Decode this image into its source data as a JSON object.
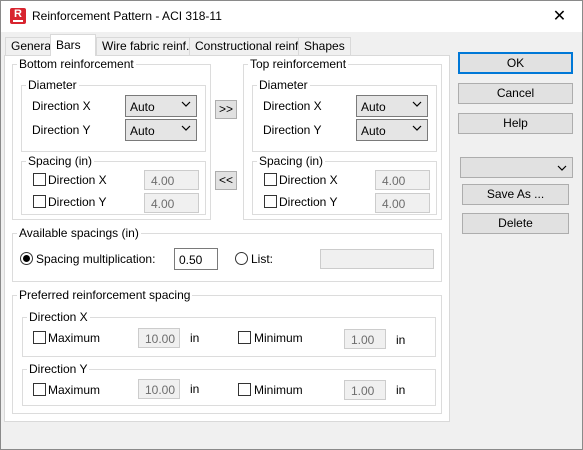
{
  "window": {
    "title": "Reinforcement Pattern - ACI 318-11",
    "close_glyph": "✕",
    "icon_letter": "R"
  },
  "tabs": [
    {
      "label": "General",
      "active": false
    },
    {
      "label": "Bars",
      "active": true
    },
    {
      "label": "Wire fabric reinf.",
      "active": false
    },
    {
      "label": "Constructional reinf.",
      "active": false
    },
    {
      "label": "Shapes",
      "active": false
    }
  ],
  "bottom": {
    "title": "Bottom reinforcement",
    "diameter": {
      "title": "Diameter",
      "x_label": "Direction X",
      "x_value": "Auto",
      "y_label": "Direction Y",
      "y_value": "Auto"
    },
    "spacing": {
      "title": "Spacing (in)",
      "x_label": "Direction X",
      "x_value": "4.00",
      "y_label": "Direction Y",
      "y_value": "4.00"
    }
  },
  "top": {
    "title": "Top reinforcement",
    "diameter": {
      "title": "Diameter",
      "x_label": "Direction X",
      "x_value": "Auto",
      "y_label": "Direction Y",
      "y_value": "Auto"
    },
    "spacing": {
      "title": "Spacing (in)",
      "x_label": "Direction X",
      "x_value": "4.00",
      "y_label": "Direction Y",
      "y_value": "4.00"
    }
  },
  "copy_buttons": {
    "to_top": ">>",
    "to_bottom": "<<"
  },
  "available": {
    "title": "Available spacings (in)",
    "mult_label": "Spacing multiplication:",
    "mult_value": "0.50",
    "list_label": "List:",
    "list_value": "",
    "selected": "multiplication"
  },
  "preferred": {
    "title": "Preferred reinforcement spacing",
    "dir_x": {
      "title": "Direction X",
      "max_label": "Maximum",
      "max_value": "10.00",
      "max_unit": "in",
      "min_label": "Minimum",
      "min_value": "1.00",
      "min_unit": "in"
    },
    "dir_y": {
      "title": "Direction Y",
      "max_label": "Maximum",
      "max_value": "10.00",
      "max_unit": "in",
      "min_label": "Minimum",
      "min_value": "1.00",
      "min_unit": "in"
    }
  },
  "side": {
    "ok": "OK",
    "cancel": "Cancel",
    "help": "Help",
    "preset_value": "",
    "save_as": "Save As ...",
    "delete": "Delete"
  },
  "colors": {
    "accent": "#0078d7",
    "app_icon": "#d8242f"
  }
}
